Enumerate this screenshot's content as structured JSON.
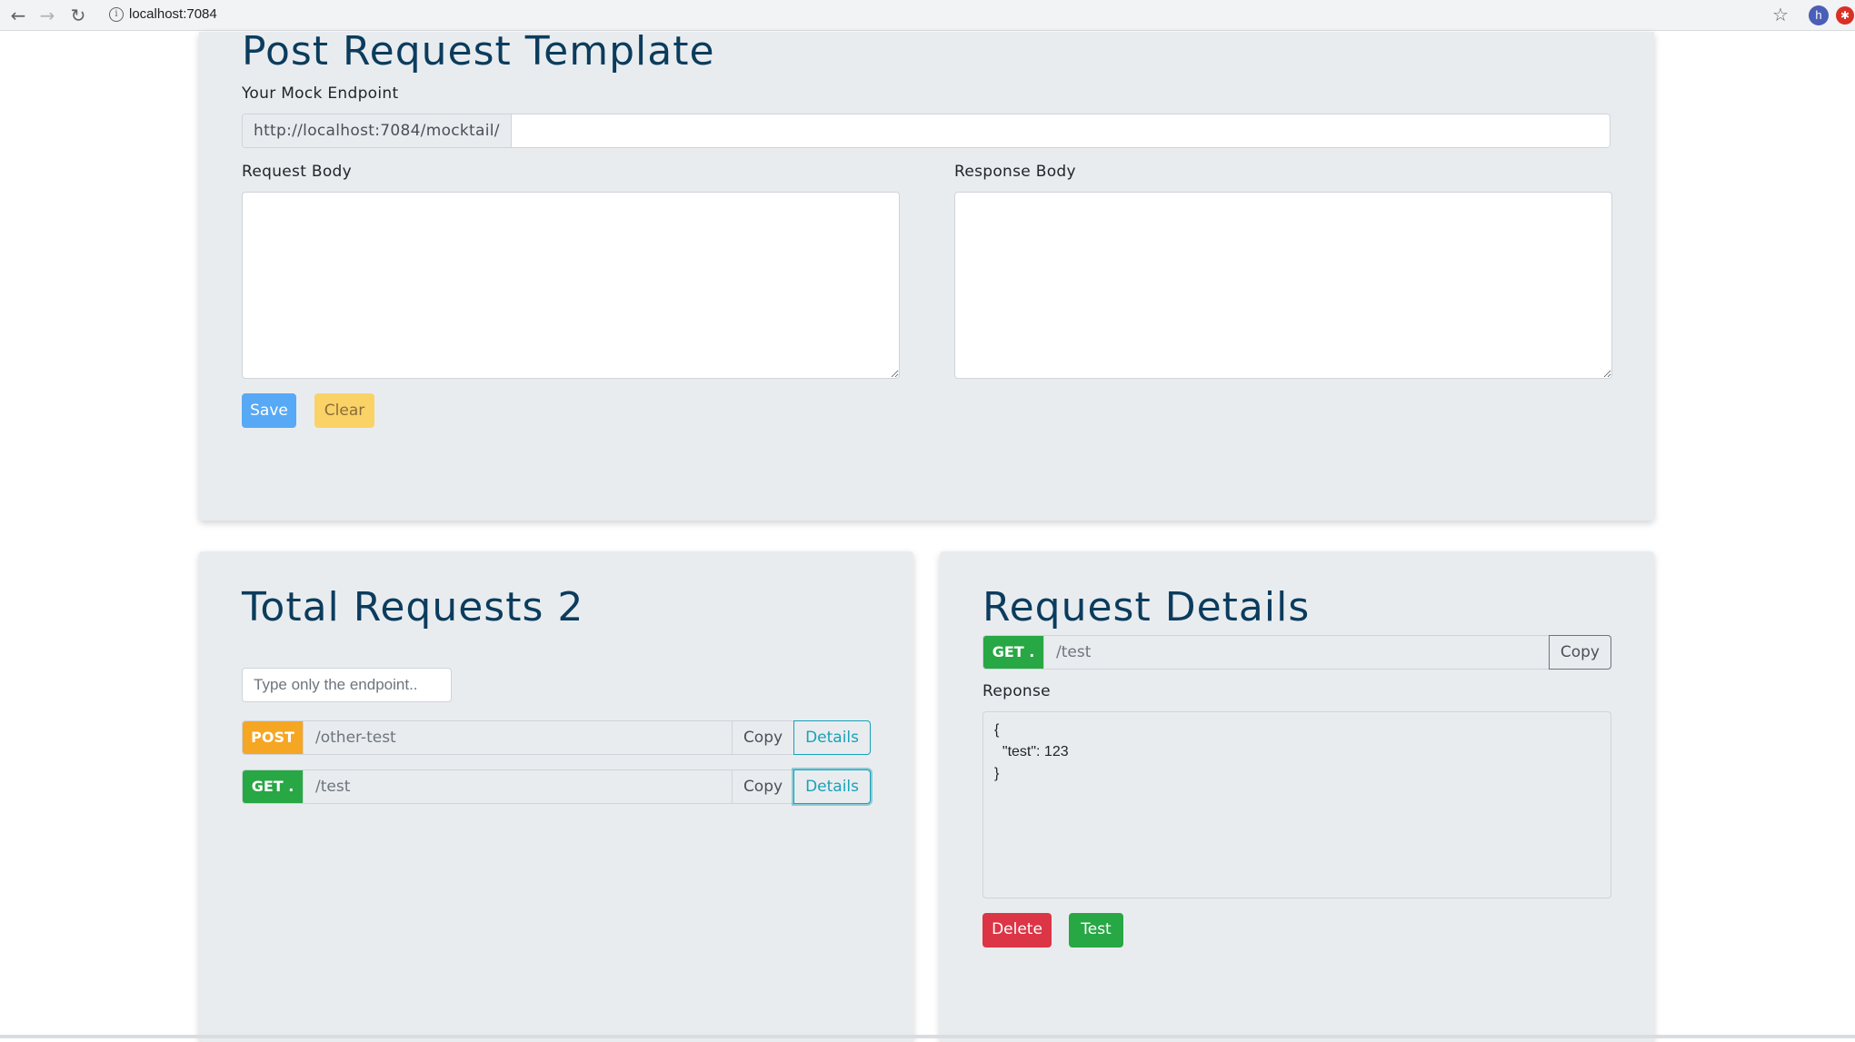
{
  "browser": {
    "url": "localhost:7084",
    "avatar_letter": "h"
  },
  "template": {
    "title": "Post Request Template",
    "endpoint_label": "Your Mock Endpoint",
    "endpoint_prefix": "http://localhost:7084/mocktail/",
    "endpoint_value": "",
    "request_body_label": "Request Body",
    "response_body_label": "Response Body",
    "request_body_value": "",
    "response_body_value": "",
    "save_label": "Save",
    "clear_label": "Clear"
  },
  "requests": {
    "title": "Total Requests 2",
    "search_placeholder": "Type only the endpoint..",
    "items": [
      {
        "method": "POST",
        "path": "/other-test",
        "copy_label": "Copy",
        "details_label": "Details"
      },
      {
        "method": "GET .",
        "path": "/test",
        "copy_label": "Copy",
        "details_label": "Details"
      }
    ]
  },
  "details": {
    "title": "Request Details",
    "method": "GET .",
    "path": "/test",
    "copy_label": "Copy",
    "response_label": "Reponse",
    "response_body": "{\n  \"test\": 123\n}",
    "delete_label": "Delete",
    "test_label": "Test"
  },
  "colors": {
    "title": "#0b3c5d",
    "post_badge": "#f5a623",
    "get_badge": "#28a745",
    "save": "#58a9f5",
    "clear": "#fbd266",
    "delete": "#dc3545",
    "test": "#28a745",
    "details": "#17a2b8"
  }
}
